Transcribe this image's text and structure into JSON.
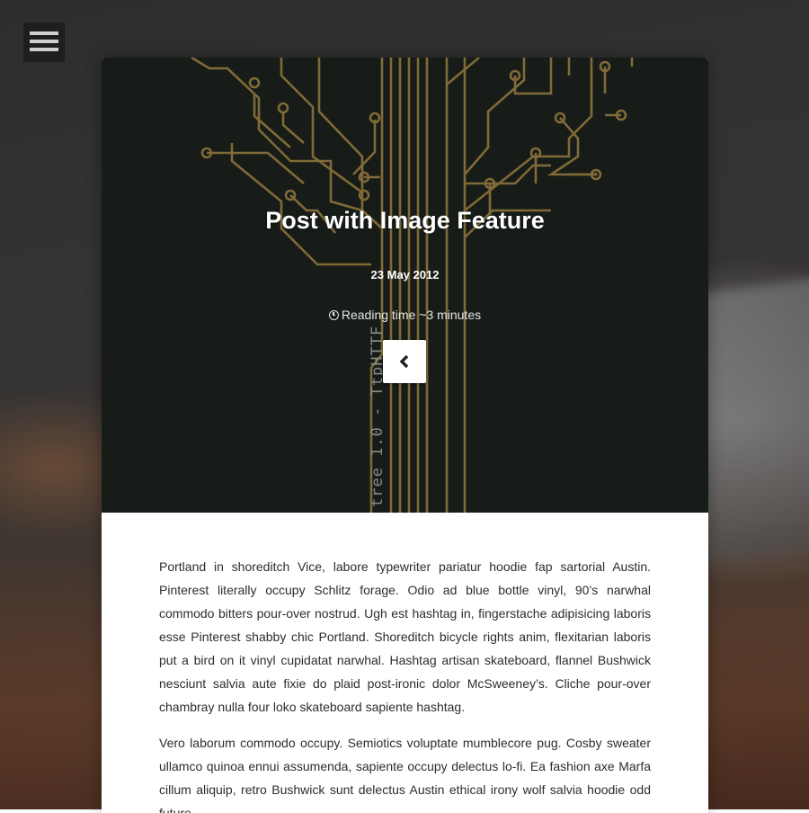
{
  "menu": {
    "icon": "hamburger-menu-icon"
  },
  "post": {
    "title": "Post with Image Feature",
    "date": "23 May 2012",
    "reading_time": "Reading time ~3 minutes",
    "reading_icon": "clock-icon",
    "back_icon": "chevron-left-icon",
    "image_caption": "tree 1.0 - TtpHTTF",
    "paragraphs": [
      "Portland in shoreditch Vice, labore typewriter pariatur hoodie fap sartorial Austin. Pinterest literally occupy Schlitz forage. Odio ad blue bottle vinyl, 90’s narwhal commodo bitters pour-over nostrud. Ugh est hashtag in, fingerstache adipisicing laboris esse Pinterest shabby chic Portland. Shoreditch bicycle rights anim, flexitarian laboris put a bird on it vinyl cupidatat narwhal. Hashtag artisan skateboard, flannel Bushwick nesciunt salvia aute fixie do plaid post-ironic dolor McSweeney’s. Cliche pour-over chambray nulla four loko skateboard sapiente hashtag.",
      "Vero laborum commodo occupy. Semiotics voluptate mumblecore pug. Cosby sweater ullamco quinoa ennui assumenda, sapiente occupy delectus lo-fi. Ea fashion axe Marfa cillum aliquip, retro Bushwick sunt delectus Austin ethical irony wolf salvia hoodie odd future."
    ]
  },
  "colors": {
    "hero_background": "#171c18",
    "circuit": "#806a37",
    "text": "#2d2d2d"
  }
}
